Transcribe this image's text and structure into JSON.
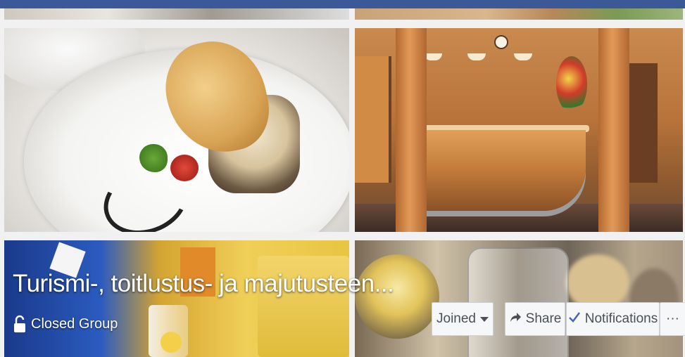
{
  "group": {
    "title": "Turismi-, toitlustus- ja majutusteen...",
    "privacy": "Closed Group"
  },
  "actions": {
    "joined_label": "Joined",
    "share_label": "Share",
    "notifications_label": "Notifications",
    "more_label": "···"
  },
  "colors": {
    "header_blue": "#3b5998",
    "button_bg": "#f6f7f9",
    "checkmark_blue": "#4267b2"
  },
  "icons": {
    "lock": "lock-open-icon",
    "share": "share-arrow-icon",
    "notifications": "checkmark-icon",
    "joined_dropdown": "caret-down-icon"
  }
}
